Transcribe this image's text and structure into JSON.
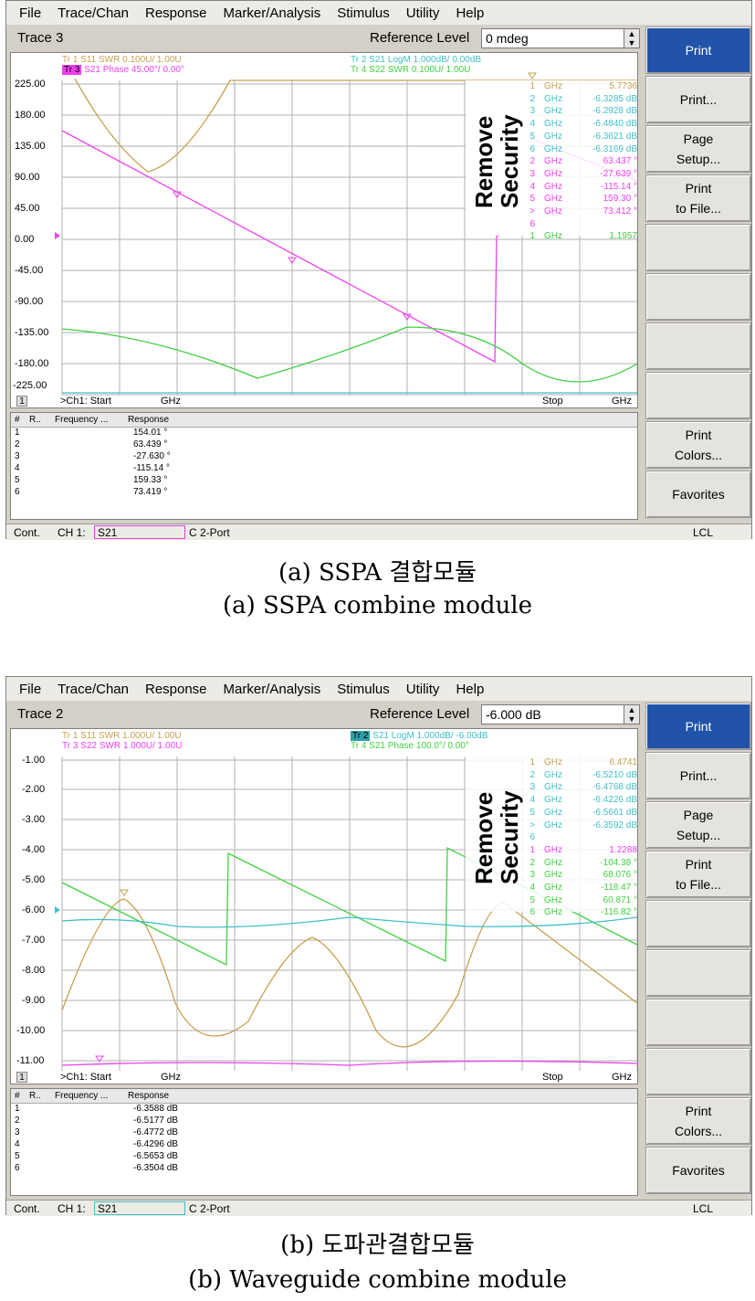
{
  "menu": [
    "File",
    "Trace/Chan",
    "Response",
    "Marker/Analysis",
    "Stimulus",
    "Utility",
    "Help"
  ],
  "sidebar": {
    "print": "Print",
    "print_dots": "Print...",
    "page_setup": "Page\nSetup...",
    "print_file": "Print\nto File...",
    "print_colors": "Print\nColors...",
    "favorites": "Favorites"
  },
  "overlay": {
    "line1": "Remove",
    "line2": "Security"
  },
  "status": {
    "cont": "Cont.",
    "ch1": "CH 1:",
    "param": "S21",
    "port": "C  2-Port",
    "lcl": "LCL"
  },
  "table_headers": {
    "num": "#",
    "r": "R..",
    "freq": "Frequency ...",
    "resp": "Response"
  },
  "colors": {
    "orange": "#c8a050",
    "cyan": "#40c0c8",
    "magenta": "#f040f0",
    "green": "#40d040"
  },
  "panelA": {
    "trace_title": "Trace 3",
    "ref_label": "Reference Level",
    "ref_value": "0 mdeg",
    "legend": [
      "Tr 1   S11 SWR 0.100U/  1.00U",
      "S21 Phase 45.00°/  0.00°",
      "Tr 2   S21 LogM 1.000dB/  0.00dB",
      "Tr 4   S22 SWR 0.100U/  1.00U"
    ],
    "yticks": [
      "225.00",
      "180.00",
      "135.00",
      "90.00",
      "45.00",
      "0.00",
      "-45.00",
      "-90.00",
      "-135.00",
      "-180.00",
      "-225.00"
    ],
    "bottom": {
      "num": "1",
      "start": ">Ch1: Start",
      "ghz": "GHz",
      "stop": "Stop",
      "ghz2": "GHz"
    },
    "markers": [
      {
        "n": "1",
        "u": "GHz",
        "v": "5.7736"
      },
      {
        "n": "2",
        "u": "GHz",
        "v": "-6.3285 dB"
      },
      {
        "n": "3",
        "u": "GHz",
        "v": "-6.2928 dB"
      },
      {
        "n": "4",
        "u": "GHz",
        "v": "-6.4840 dB"
      },
      {
        "n": "5",
        "u": "GHz",
        "v": "-6.3621 dB"
      },
      {
        "n": "6",
        "u": "GHz",
        "v": "-6.3169 dB"
      },
      {
        "n": "2",
        "u": "GHz",
        "v": "63.437 °"
      },
      {
        "n": "3",
        "u": "GHz",
        "v": "-27.639 °"
      },
      {
        "n": "4",
        "u": "GHz",
        "v": "-115.14 °"
      },
      {
        "n": "5",
        "u": "GHz",
        "v": "159.30 °"
      },
      {
        "n": "> 6",
        "u": "GHz",
        "v": "73.412 °"
      },
      {
        "n": "1",
        "u": "GHz",
        "v": "1.1957"
      }
    ],
    "rows": [
      {
        "n": "1",
        "v": "154.01 °"
      },
      {
        "n": "2",
        "v": "63.439 °"
      },
      {
        "n": "3",
        "v": "-27.630 °"
      },
      {
        "n": "4",
        "v": "-115.14 °"
      },
      {
        "n": "5",
        "v": "159.33 °"
      },
      {
        "n": "6",
        "v": "73.419 °"
      }
    ]
  },
  "panelB": {
    "trace_title": "Trace 2",
    "ref_label": "Reference Level",
    "ref_value": "-6.000 dB",
    "legend": [
      "Tr 1   S11 SWR 1.000U/  1.00U",
      "Tr 3   S22 SWR 1.000U/  1.00U",
      "S21 LogM 1.000dB/  -6.00dB",
      "Tr 4   S21 Phase 100.0°/  0.00°"
    ],
    "yticks": [
      "-1.00",
      "-2.00",
      "-3.00",
      "-4.00",
      "-5.00",
      "-6.00",
      "-7.00",
      "-8.00",
      "-9.00",
      "-10.00",
      "-11.00"
    ],
    "bottom": {
      "num": "1",
      "start": ">Ch1: Start",
      "ghz": "GHz",
      "stop": "Stop",
      "ghz2": "GHz"
    },
    "markers": [
      {
        "n": "1",
        "u": "GHz",
        "v": "6.4741"
      },
      {
        "n": "2",
        "u": "GHz",
        "v": "-6.5210 dB"
      },
      {
        "n": "3",
        "u": "GHz",
        "v": "-6.4768 dB"
      },
      {
        "n": "4",
        "u": "GHz",
        "v": "-6.4226 dB"
      },
      {
        "n": "5",
        "u": "GHz",
        "v": "-6.5661 dB"
      },
      {
        "n": "> 6",
        "u": "GHz",
        "v": "-6.3592 dB"
      },
      {
        "n": "1",
        "u": "GHz",
        "v": "1.2288"
      },
      {
        "n": "2",
        "u": "GHz",
        "v": "-104.38 °"
      },
      {
        "n": "3",
        "u": "GHz",
        "v": "68.076 °"
      },
      {
        "n": "4",
        "u": "GHz",
        "v": "-118.47 °"
      },
      {
        "n": "5",
        "u": "GHz",
        "v": "60.871 °"
      },
      {
        "n": "6",
        "u": "GHz",
        "v": "-116.82 °"
      }
    ],
    "rows": [
      {
        "n": "1",
        "v": "-6.3588 dB"
      },
      {
        "n": "2",
        "v": "-6.5177 dB"
      },
      {
        "n": "3",
        "v": "-6.4772 dB"
      },
      {
        "n": "4",
        "v": "-6.4296 dB"
      },
      {
        "n": "5",
        "v": "-6.5653 dB"
      },
      {
        "n": "6",
        "v": "-6.3504 dB"
      }
    ]
  },
  "captions": {
    "a_kr": "(a)  SSPA  결합모듈",
    "a_en": "(a)  SSPA  combine  module",
    "b_kr": "(b)  도파관결합모듈",
    "b_en": "(b)  Waveguide  combine  module"
  }
}
